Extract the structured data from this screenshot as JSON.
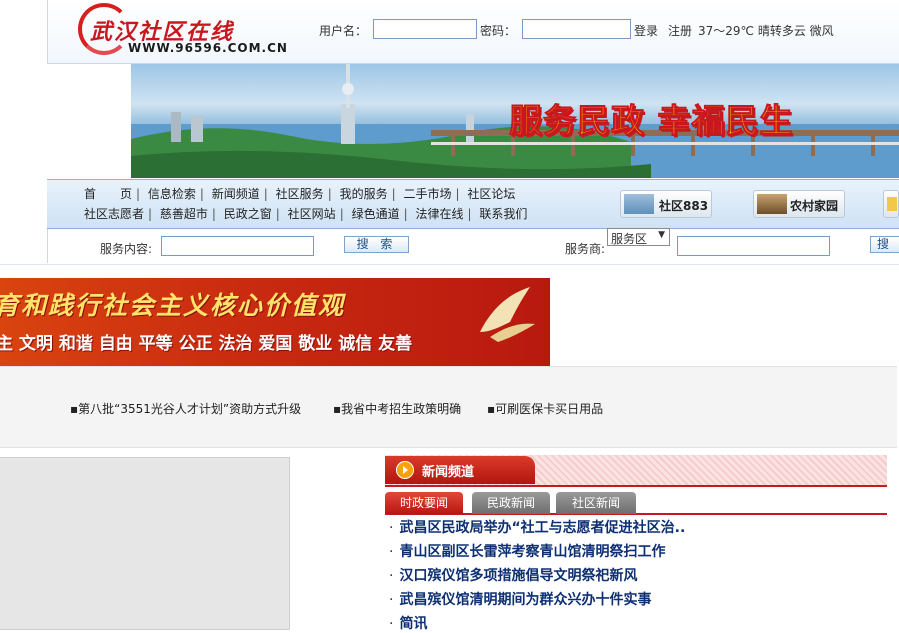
{
  "header": {
    "logo_text": "武汉社区在线",
    "logo_url": "WWW.96596.COM.CN",
    "username_label": "用户名：",
    "password_label": "密码：",
    "username_value": "",
    "password_value": "",
    "login_label": "登录",
    "register_label": "注册",
    "weather": "37～29℃ 晴转多云 微风"
  },
  "banner": {
    "slogan": "服务民政 幸福民生"
  },
  "nav": {
    "row1": [
      "首　　页",
      "信息检索",
      "新闻频道",
      "社区服务",
      "我的服务",
      "二手市场",
      "社区论坛"
    ],
    "row2": [
      "社区志愿者",
      "慈善超市",
      "民政之窗",
      "社区网站",
      "绿色通道",
      "法律在线",
      "联系我们"
    ],
    "pills": [
      "社区883",
      "农村家园"
    ]
  },
  "search": {
    "content_label": "服务内容:",
    "content_value": "",
    "search_button": "搜 索",
    "provider_label": "服务商:",
    "provider_select": "服务区",
    "provider_value": "",
    "search_button2": "搜"
  },
  "values_banner": {
    "line1": "育和践行社会主义核心价值观",
    "line2": "主 文明 和谐  自由 平等 公正 法治  爱国 敬业 诚信 友善"
  },
  "ticker": [
    "▪第八批“3551光谷人才计划”资助方式升级",
    "▪我省中考招生政策明确",
    "▪可刷医保卡买日用品"
  ],
  "news": {
    "title": "新闻频道",
    "tabs": [
      "时政要闻",
      "民政新闻",
      "社区新闻"
    ],
    "bullet": "·",
    "items": [
      "武昌区民政局举办“社工与志愿者促进社区治..",
      "青山区副区长雷萍考察青山馆清明祭扫工作",
      "汉口殡仪馆多项措施倡导文明祭祀新风",
      "武昌殡仪馆清明期间为群众兴办十件实事",
      "简讯"
    ]
  },
  "colors": {
    "brand_red": "#c9171e",
    "nav_blue": "#cfe2f4",
    "link_navy": "#0d2f73",
    "slogan_yellow": "#f7d400"
  }
}
